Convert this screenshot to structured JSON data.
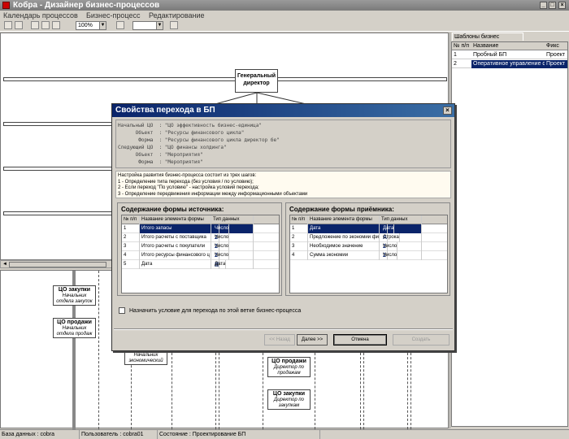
{
  "window": {
    "title": "Кобра - Дизайнер бизнес-процессов"
  },
  "menu": [
    "Календарь процессов",
    "Бизнес-процесс",
    "Редактирование"
  ],
  "toolbar": {
    "zoom": "100%",
    "combo2": ""
  },
  "diagram": {
    "top_node": [
      "Генеральный",
      "директор"
    ],
    "nodes": [
      {
        "title": "ЦО закупки",
        "subtitle": [
          "Начальник",
          "отдела закупок"
        ]
      },
      {
        "title": "ЦО продажи",
        "subtitle": [
          "Начальник",
          "отдела продаж"
        ]
      },
      {
        "title": "",
        "subtitle": [
          "Начальник",
          "экономический"
        ]
      },
      {
        "title": "ЦО продажи",
        "subtitle": [
          "Директор по",
          "продажам"
        ]
      },
      {
        "title": "ЦО закупки",
        "subtitle": [
          "Директор по",
          "закупкам"
        ]
      }
    ]
  },
  "templates_panel": {
    "tab": "Шаблоны бизнес процессов",
    "columns": [
      "№ п/п",
      "Название",
      "Фикс"
    ],
    "rows": [
      {
        "n": "1",
        "name": "Пробный БП",
        "fix": "Проект"
      },
      {
        "n": "2",
        "name": "Оперативное управление фина",
        "fix": "Проект"
      }
    ]
  },
  "status": {
    "db": "База данных : cobra",
    "user": "Пользователь : cobra01",
    "state": "Состояние : Проектирование БП"
  },
  "dialog": {
    "title": "Свойства перехода в БП",
    "info": [
      "Начальный ЦО  : \"ЦО эффективность бизнес-единица\"",
      "      Объект  : \"Ресурсы финансового цикла\"",
      "       Форма  : \"Ресурсы финансового цикла директор бе\"",
      "Следующий ЦО  : \"ЦО финансы холдинга\"",
      "      Объект  : \"Мероприятия\"",
      "       Форма  : \"Мероприятия\""
    ],
    "description": [
      "Настройка развития бизнес-процесса состоит из трех шагов:",
      "1 - Определение типа перехода (без условия / по условию);",
      "2 - Если переход \"По условию\" - настройка условий перехода;",
      "3 - Определение передвижения информации между информационными объектами"
    ],
    "source": {
      "title": "Содержание формы источника:",
      "columns": [
        "№ п/п",
        "Название элемента формы",
        "Тип данных"
      ],
      "rows": [
        {
          "n": "1",
          "name": "Итого запасы",
          "icon": "",
          "type": "Число"
        },
        {
          "n": "2",
          "name": "Итого расчеты с поставщика",
          "icon": "2",
          "type": "Число"
        },
        {
          "n": "3",
          "name": "Итого расчеты с покупатели",
          "icon": "2",
          "type": "Число"
        },
        {
          "n": "4",
          "name": "Итого ресурсы финансового ц",
          "icon": "2",
          "type": "Число"
        },
        {
          "n": "5",
          "name": "Дата",
          "icon": "▦",
          "type": "Дата"
        }
      ]
    },
    "target": {
      "title": "Содержание формы приёмника:",
      "columns": [
        "№ п/п",
        "Название элемента формы",
        "Тип данных"
      ],
      "rows": [
        {
          "n": "1",
          "name": "Дата",
          "icon": "▦",
          "type": "Дата"
        },
        {
          "n": "2",
          "name": "Предложение по экономии фи",
          "icon": "A",
          "type": "Строка"
        },
        {
          "n": "3",
          "name": "Необходимое значение",
          "icon": "2",
          "type": "Число"
        },
        {
          "n": "4",
          "name": "Сумма экономии",
          "icon": "2",
          "type": "Число"
        }
      ]
    },
    "condition_label": "Назначить условие для перехода по этой ветке бизнес-процесса",
    "buttons": {
      "back": "<< Назад",
      "next": "Далее >>",
      "cancel": "Отмена",
      "create": "Создать"
    }
  }
}
